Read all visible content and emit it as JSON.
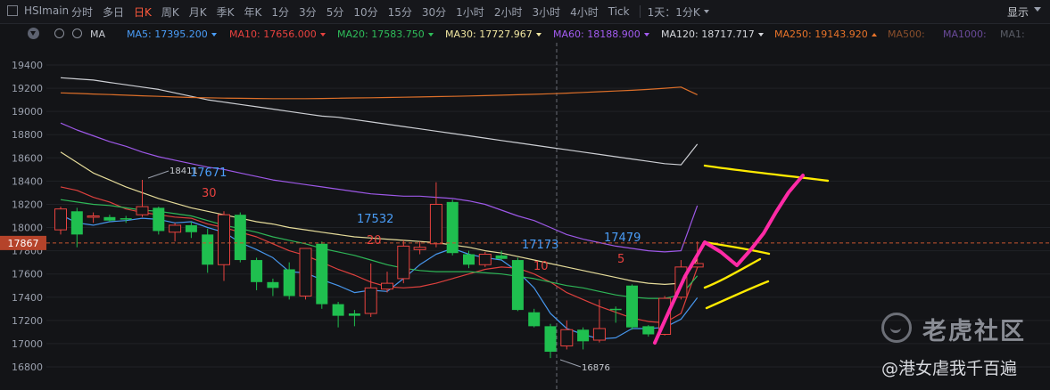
{
  "topbar": {
    "symbol": "HSImain",
    "timeframes": [
      "分时",
      "多日",
      "日K",
      "周K",
      "月K",
      "季K",
      "年K",
      "1分",
      "3分",
      "5分",
      "10分",
      "15分",
      "30分",
      "1小时",
      "2小时",
      "3小时",
      "4小时",
      "Tick"
    ],
    "active_timeframe": "日K",
    "combo": "1天：1分K",
    "display_label": "显示"
  },
  "ma_bar": {
    "label": "MA",
    "items": [
      {
        "name": "MA5",
        "value": "17395.200",
        "color": "#4a9df8",
        "arrow": "down"
      },
      {
        "name": "MA10",
        "value": "17656.000",
        "color": "#e8423f",
        "arrow": "down"
      },
      {
        "name": "MA20",
        "value": "17583.750",
        "color": "#2fbf5b",
        "arrow": "down"
      },
      {
        "name": "MA30",
        "value": "17727.967",
        "color": "#f1e7a1",
        "arrow": "down"
      },
      {
        "name": "MA60",
        "value": "18188.900",
        "color": "#a45cf2",
        "arrow": "down"
      },
      {
        "name": "MA120",
        "value": "18717.717",
        "color": "#d7d9de",
        "arrow": "down"
      },
      {
        "name": "MA250",
        "value": "19143.920",
        "color": "#e8742a",
        "arrow": "up"
      },
      {
        "name": "MA500",
        "value": "",
        "color": "#8a4f2c",
        "arrow": ""
      },
      {
        "name": "MA1000",
        "value": "",
        "color": "#6a4a9a",
        "arrow": ""
      },
      {
        "name": "MA1",
        "value": "",
        "color": "#5a5d66",
        "arrow": ""
      }
    ]
  },
  "watermark": {
    "brand": "老虎社区",
    "user": "@港女虐我千百遍"
  },
  "chart_data": {
    "type": "candlestick",
    "ylim": [
      16750,
      19470
    ],
    "y_ticks": [
      16800,
      17000,
      17200,
      17400,
      17600,
      17800,
      18000,
      18200,
      18400,
      18600,
      18800,
      19000,
      19200,
      19400
    ],
    "current_price": "17867",
    "candles": [
      {
        "o": 17980,
        "h": 18180,
        "l": 17940,
        "c": 18160
      },
      {
        "o": 18140,
        "h": 18170,
        "l": 17830,
        "c": 17940
      },
      {
        "o": 18090,
        "h": 18130,
        "l": 18040,
        "c": 18100
      },
      {
        "o": 18090,
        "h": 18110,
        "l": 18050,
        "c": 18060
      },
      {
        "o": 18080,
        "h": 18100,
        "l": 18040,
        "c": 18070
      },
      {
        "o": 18110,
        "h": 18411,
        "l": 18090,
        "c": 18180
      },
      {
        "o": 18170,
        "h": 18180,
        "l": 17940,
        "c": 17970
      },
      {
        "o": 17960,
        "h": 18040,
        "l": 17880,
        "c": 18020
      },
      {
        "o": 18020,
        "h": 18050,
        "l": 17910,
        "c": 17960
      },
      {
        "o": 17940,
        "h": 17990,
        "l": 17610,
        "c": 17680
      },
      {
        "o": 17680,
        "h": 18140,
        "l": 17540,
        "c": 18110
      },
      {
        "o": 18110,
        "h": 18130,
        "l": 17700,
        "c": 17720
      },
      {
        "o": 17720,
        "h": 17740,
        "l": 17460,
        "c": 17530
      },
      {
        "o": 17530,
        "h": 17560,
        "l": 17410,
        "c": 17480
      },
      {
        "o": 17640,
        "h": 17700,
        "l": 17380,
        "c": 17410
      },
      {
        "o": 17410,
        "h": 17820,
        "l": 17380,
        "c": 17820
      },
      {
        "o": 17860,
        "h": 17880,
        "l": 17300,
        "c": 17340
      },
      {
        "o": 17340,
        "h": 17360,
        "l": 17140,
        "c": 17240
      },
      {
        "o": 17260,
        "h": 17290,
        "l": 17150,
        "c": 17240
      },
      {
        "o": 17260,
        "h": 17690,
        "l": 17230,
        "c": 17480
      },
      {
        "o": 17470,
        "h": 17620,
        "l": 17440,
        "c": 17520
      },
      {
        "o": 17560,
        "h": 17890,
        "l": 17520,
        "c": 17840
      },
      {
        "o": 17810,
        "h": 17880,
        "l": 17770,
        "c": 17830
      },
      {
        "o": 17860,
        "h": 18390,
        "l": 17830,
        "c": 18200
      },
      {
        "o": 18220,
        "h": 18240,
        "l": 17760,
        "c": 17780
      },
      {
        "o": 17770,
        "h": 17800,
        "l": 17650,
        "c": 17680
      },
      {
        "o": 17680,
        "h": 17790,
        "l": 17660,
        "c": 17770
      },
      {
        "o": 17760,
        "h": 17800,
        "l": 17720,
        "c": 17730
      },
      {
        "o": 17720,
        "h": 17740,
        "l": 17280,
        "c": 17290
      },
      {
        "o": 17270,
        "h": 17300,
        "l": 17140,
        "c": 17150
      },
      {
        "o": 17150,
        "h": 17170,
        "l": 16876,
        "c": 16930
      },
      {
        "o": 16980,
        "h": 17200,
        "l": 16950,
        "c": 17120
      },
      {
        "o": 17120,
        "h": 17140,
        "l": 16950,
        "c": 17020
      },
      {
        "o": 17030,
        "h": 17380,
        "l": 17010,
        "c": 17130
      },
      {
        "o": 17300,
        "h": 17320,
        "l": 17180,
        "c": 17290
      },
      {
        "o": 17500,
        "h": 17510,
        "l": 17120,
        "c": 17140
      },
      {
        "o": 17150,
        "h": 17160,
        "l": 17060,
        "c": 17080
      },
      {
        "o": 17080,
        "h": 17410,
        "l": 17070,
        "c": 17390
      },
      {
        "o": 17400,
        "h": 17720,
        "l": 17380,
        "c": 17660
      },
      {
        "o": 17660,
        "h": 17880,
        "l": 17650,
        "c": 17690
      }
    ],
    "ma_series": [
      {
        "name": "MA5",
        "color": "#4a9df8",
        "values": [
          18110,
          18040,
          18020,
          18050,
          18060,
          18080,
          18070,
          18040,
          18050,
          18000,
          17960,
          17870,
          17810,
          17740,
          17620,
          17610,
          17550,
          17500,
          17440,
          17460,
          17450,
          17560,
          17680,
          17770,
          17820,
          17770,
          17740,
          17720,
          17620,
          17480,
          17260,
          17130,
          17080,
          17040,
          17050,
          17130,
          17130,
          17140,
          17210,
          17395
        ]
      },
      {
        "name": "MA10",
        "color": "#e8423f",
        "values": [
          18350,
          18320,
          18260,
          18220,
          18160,
          18130,
          18110,
          18090,
          18080,
          18030,
          18000,
          17960,
          17920,
          17860,
          17800,
          17760,
          17700,
          17640,
          17590,
          17530,
          17490,
          17480,
          17490,
          17520,
          17560,
          17600,
          17640,
          17660,
          17650,
          17600,
          17530,
          17440,
          17380,
          17320,
          17270,
          17220,
          17190,
          17180,
          17260,
          17656
        ]
      },
      {
        "name": "MA20",
        "color": "#2fbf5b",
        "values": [
          18240,
          18220,
          18200,
          18190,
          18170,
          18150,
          18140,
          18120,
          18100,
          18060,
          18020,
          17990,
          17960,
          17920,
          17890,
          17860,
          17820,
          17790,
          17760,
          17720,
          17680,
          17650,
          17630,
          17620,
          17620,
          17620,
          17610,
          17600,
          17580,
          17560,
          17530,
          17500,
          17480,
          17450,
          17420,
          17400,
          17390,
          17390,
          17420,
          17584
        ]
      },
      {
        "name": "MA30",
        "color": "#f1e7a1",
        "values": [
          18650,
          18560,
          18470,
          18410,
          18350,
          18300,
          18250,
          18210,
          18170,
          18140,
          18110,
          18080,
          18050,
          18030,
          18000,
          17980,
          17960,
          17940,
          17920,
          17910,
          17900,
          17890,
          17880,
          17870,
          17850,
          17830,
          17800,
          17780,
          17750,
          17720,
          17690,
          17660,
          17630,
          17600,
          17570,
          17540,
          17520,
          17510,
          17520,
          17728
        ]
      },
      {
        "name": "MA60",
        "color": "#a45cf2",
        "values": [
          18900,
          18840,
          18790,
          18740,
          18700,
          18650,
          18610,
          18580,
          18550,
          18520,
          18500,
          18470,
          18440,
          18410,
          18390,
          18370,
          18350,
          18330,
          18310,
          18290,
          18280,
          18270,
          18270,
          18260,
          18250,
          18230,
          18200,
          18150,
          18100,
          18060,
          18000,
          17940,
          17900,
          17870,
          17840,
          17820,
          17800,
          17790,
          17800,
          18189
        ]
      },
      {
        "name": "MA120",
        "color": "#d7d9de",
        "values": [
          19290,
          19280,
          19270,
          19250,
          19230,
          19210,
          19190,
          19160,
          19130,
          19100,
          19080,
          19060,
          19040,
          19020,
          19000,
          18980,
          18960,
          18950,
          18930,
          18910,
          18890,
          18870,
          18850,
          18830,
          18810,
          18790,
          18770,
          18750,
          18730,
          18710,
          18690,
          18670,
          18650,
          18630,
          18610,
          18590,
          18570,
          18550,
          18540,
          18718
        ]
      },
      {
        "name": "MA250",
        "color": "#e8742a",
        "values": [
          19160,
          19155,
          19150,
          19145,
          19140,
          19135,
          19130,
          19125,
          19120,
          19118,
          19115,
          19113,
          19112,
          19110,
          19110,
          19110,
          19112,
          19114,
          19116,
          19118,
          19120,
          19122,
          19125,
          19128,
          19130,
          19133,
          19136,
          19140,
          19144,
          19148,
          19152,
          19158,
          19164,
          19170,
          19176,
          19182,
          19190,
          19200,
          19210,
          19144
        ]
      }
    ],
    "annotations": [
      {
        "text": "18411",
        "value": 18411,
        "color": "#c9ccd3"
      },
      {
        "text": "17671",
        "color": "#4a9df8"
      },
      {
        "text": "30",
        "color": "#e8423f"
      },
      {
        "text": "17532",
        "color": "#4a9df8"
      },
      {
        "text": "20",
        "color": "#e8423f"
      },
      {
        "text": "17173",
        "color": "#4a9df8"
      },
      {
        "text": "10",
        "color": "#e8423f"
      },
      {
        "text": "17479",
        "color": "#4a9df8"
      },
      {
        "text": "5",
        "color": "#e8423f"
      },
      {
        "text": "16876",
        "value": 16876,
        "color": "#c9ccd3"
      }
    ],
    "colors": {
      "up": "#e8423f",
      "down": "#1fbf4f",
      "grid": "#202227",
      "hand_yellow": "#ffea00",
      "hand_pink": "#ff2aa6",
      "price_line": "#c7562f"
    }
  }
}
